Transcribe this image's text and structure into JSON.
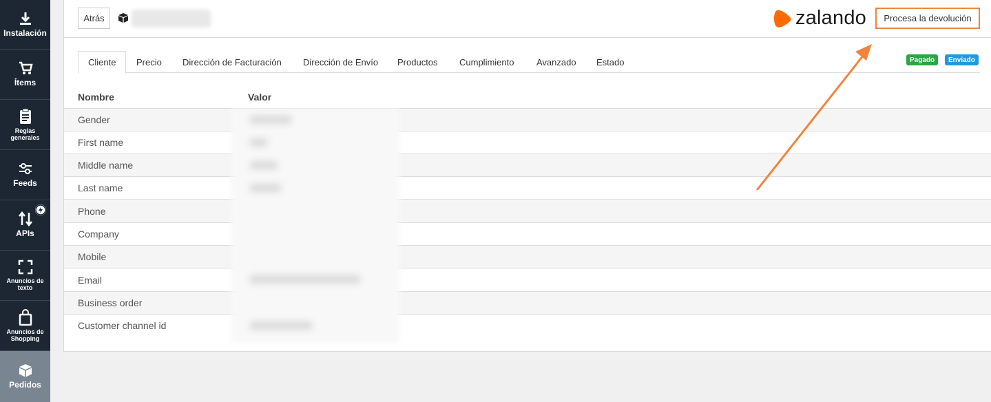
{
  "sidebar": {
    "items": [
      {
        "label": "Instalación",
        "icon": "download-icon"
      },
      {
        "label": "Ítems",
        "icon": "cart-icon"
      },
      {
        "label": "Reglas generales",
        "icon": "clipboard-icon"
      },
      {
        "label": "Feeds",
        "icon": "sliders-icon"
      },
      {
        "label": "APIs",
        "icon": "swap-arrows-icon"
      },
      {
        "label": "Anuncios de texto",
        "icon": "frame-corners-icon"
      },
      {
        "label": "Anuncios de Shopping",
        "icon": "shopping-bag-icon"
      },
      {
        "label": "Pedidos",
        "icon": "box-icon",
        "active": true
      }
    ]
  },
  "header": {
    "back_label": "Atrás",
    "brand": "zalando",
    "return_button": "Procesa la devolución"
  },
  "tabs": [
    {
      "label": "Cliente",
      "active": true
    },
    {
      "label": "Precio"
    },
    {
      "label": "Dirección de Facturación"
    },
    {
      "label": "Dirección de Envío"
    },
    {
      "label": "Productos"
    },
    {
      "label": "Cumplimiento"
    },
    {
      "label": "Avanzado"
    },
    {
      "label": "Estado"
    }
  ],
  "status_badges": [
    {
      "label": "Pagado",
      "color": "#28a745"
    },
    {
      "label": "Enviado",
      "color": "#1e9be0"
    }
  ],
  "table": {
    "columns": [
      "Nombre",
      "Valor"
    ],
    "rows": [
      "Gender",
      "First name",
      "Middle name",
      "Last name",
      "Phone",
      "Company",
      "Mobile",
      "Email",
      "Business order",
      "Customer channel id"
    ]
  },
  "colors": {
    "sidebar_bg": "#1d2733",
    "sidebar_active": "#7a8592",
    "accent_orange": "#f0843c",
    "brand_orange": "#ff6900"
  }
}
